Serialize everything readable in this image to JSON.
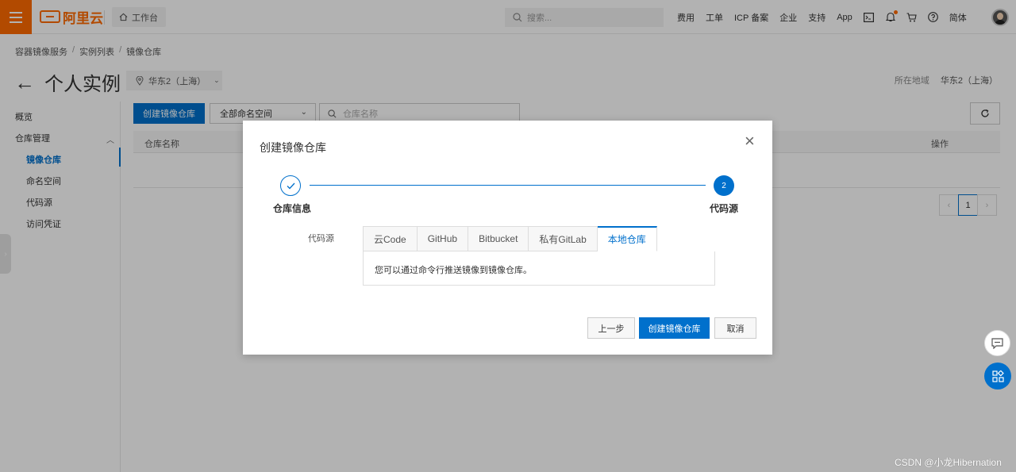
{
  "topbar": {
    "logo_text": "阿里云",
    "workbench_label": "工作台",
    "search_placeholder": "搜索...",
    "nav": [
      "费用",
      "工单",
      "ICP 备案",
      "企业",
      "支持",
      "App"
    ],
    "lang_label": "简体"
  },
  "breadcrumb": [
    "容器镜像服务",
    "实例列表",
    "镜像仓库"
  ],
  "page": {
    "title": "个人实例",
    "region_select": "华东2（上海）",
    "region_info_label": "所在地域",
    "region_info_value": "华东2（上海）"
  },
  "sidebar": {
    "overview": "概览",
    "repo_mgmt": "仓库管理",
    "items": [
      "镜像仓库",
      "命名空间",
      "代码源",
      "访问凭证"
    ]
  },
  "toolbar": {
    "create_button": "创建镜像仓库",
    "namespace_select": "全部命名空间",
    "search_placeholder": "仓库名称"
  },
  "table": {
    "columns": [
      "仓库名称",
      "操作"
    ]
  },
  "pager": {
    "current": "1"
  },
  "modal": {
    "title": "创建镜像仓库",
    "steps": [
      {
        "number": "1",
        "label": "仓库信息",
        "status": "done"
      },
      {
        "number": "2",
        "label": "代码源",
        "status": "current"
      }
    ],
    "field_label": "代码源",
    "tabs": [
      "云Code",
      "GitHub",
      "Bitbucket",
      "私有GitLab",
      "本地仓库"
    ],
    "active_tab": "本地仓库",
    "tab_content": "您可以通过命令行推送镜像到镜像仓库。",
    "prev_button": "上一步",
    "submit_button": "创建镜像仓库",
    "cancel_button": "取消"
  },
  "watermark": "CSDN @小龙Hibernation",
  "colors": {
    "brand_orange": "#ff6a00",
    "primary_blue": "#0070cc"
  }
}
